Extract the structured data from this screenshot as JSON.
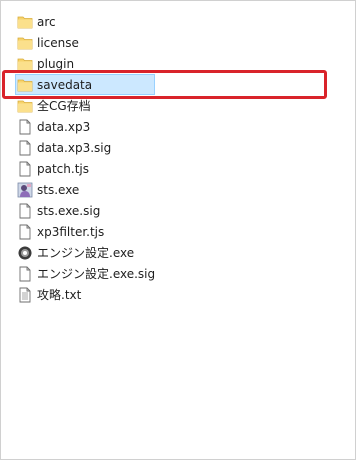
{
  "files": [
    {
      "name": "arc",
      "icon": "folder-icon"
    },
    {
      "name": "license",
      "icon": "folder-icon"
    },
    {
      "name": "plugin",
      "icon": "folder-icon"
    },
    {
      "name": "savedata",
      "icon": "folder-icon",
      "selected": true
    },
    {
      "name": "全CG存档",
      "icon": "folder-icon"
    },
    {
      "name": "data.xp3",
      "icon": "file-icon"
    },
    {
      "name": "data.xp3.sig",
      "icon": "file-icon"
    },
    {
      "name": "patch.tjs",
      "icon": "file-icon"
    },
    {
      "name": "sts.exe",
      "icon": "app-icon"
    },
    {
      "name": "sts.exe.sig",
      "icon": "file-icon"
    },
    {
      "name": "xp3filter.tjs",
      "icon": "file-icon"
    },
    {
      "name": "エンジン設定.exe",
      "icon": "settings-app-icon"
    },
    {
      "name": "エンジン設定.exe.sig",
      "icon": "file-icon"
    },
    {
      "name": "攻略.txt",
      "icon": "text-file-icon"
    }
  ],
  "colors": {
    "selection": "#cce8ff",
    "selection_border": "#99d1ff",
    "highlight_box": "#d9232a",
    "folder": "#f7d36b"
  }
}
